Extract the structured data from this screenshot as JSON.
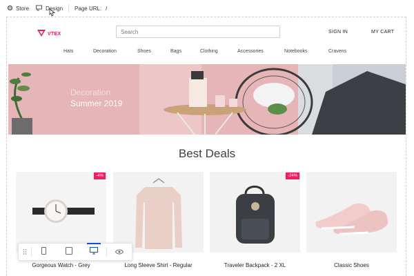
{
  "admin_bar": {
    "store_label": "Store",
    "design_label": "Design",
    "page_url_label": "Page URL:",
    "page_url_value": "/"
  },
  "header": {
    "logo_text": "VTEX",
    "search_placeholder": "Search",
    "sign_in": "SIGN IN",
    "cart": "MY CART"
  },
  "nav": {
    "items": [
      "Hats",
      "Decoration",
      "Shoes",
      "Bags",
      "Clothing",
      "Accessories",
      "Notebooks",
      "Cravens"
    ]
  },
  "hero": {
    "line1": "Decoration",
    "line2": "Summer 2019"
  },
  "section": {
    "title": "Best Deals"
  },
  "products": [
    {
      "name": "Gorgeous Watch - Grey",
      "badge": "-4%"
    },
    {
      "name": "Long Sleeve Shirt - Regular",
      "badge": ""
    },
    {
      "name": "Traveler Backpack - 2 XL",
      "badge": "-24%"
    },
    {
      "name": "Classic Shoes",
      "badge": ""
    }
  ],
  "device_toolbar": {
    "active": "desktop",
    "buttons": [
      "drag-handle",
      "mobile",
      "tablet",
      "desktop",
      "preview"
    ]
  },
  "colors": {
    "brand": "#f71963",
    "accent": "#134cd8",
    "hero_bg": "#e8b8ba"
  }
}
